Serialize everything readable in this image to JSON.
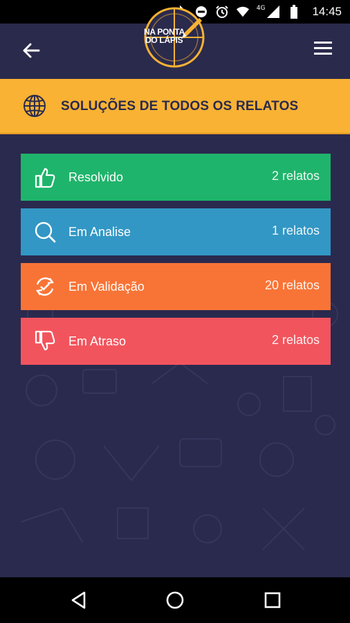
{
  "status_bar": {
    "time": "14:45",
    "network": "4G",
    "icons": [
      "bluetooth-icon",
      "do-not-disturb-icon",
      "alarm-icon",
      "wifi-icon",
      "cell-signal-icon",
      "battery-icon"
    ]
  },
  "header": {
    "logo_line1": "NA PONTA",
    "logo_line2": "DO LÁPIS",
    "back_icon": "arrow-left-icon",
    "menu_icon": "hamburger-menu-icon"
  },
  "title_band": {
    "title": "SOLUÇÕES DE TODOS OS RELATOS",
    "icon": "globe-icon"
  },
  "statuses": [
    {
      "label": "Resolvido",
      "count": "2 relatos",
      "icon": "thumbs-up-icon",
      "color": "#1fb46b"
    },
    {
      "label": "Em Analise",
      "count": "1 relatos",
      "icon": "magnifier-icon",
      "color": "#3297c4"
    },
    {
      "label": "Em Validação",
      "count": "20 relatos",
      "icon": "refresh-check-icon",
      "color": "#f87436"
    },
    {
      "label": "Em Atraso",
      "count": "2 relatos",
      "icon": "thumbs-down-icon",
      "color": "#f2545d"
    }
  ],
  "colors": {
    "background": "#2a2a4e",
    "accent_yellow": "#f9b233",
    "header": "#2a2a4c"
  },
  "nav": {
    "icons": [
      "back-triangle-icon",
      "home-circle-icon",
      "recents-square-icon"
    ]
  }
}
